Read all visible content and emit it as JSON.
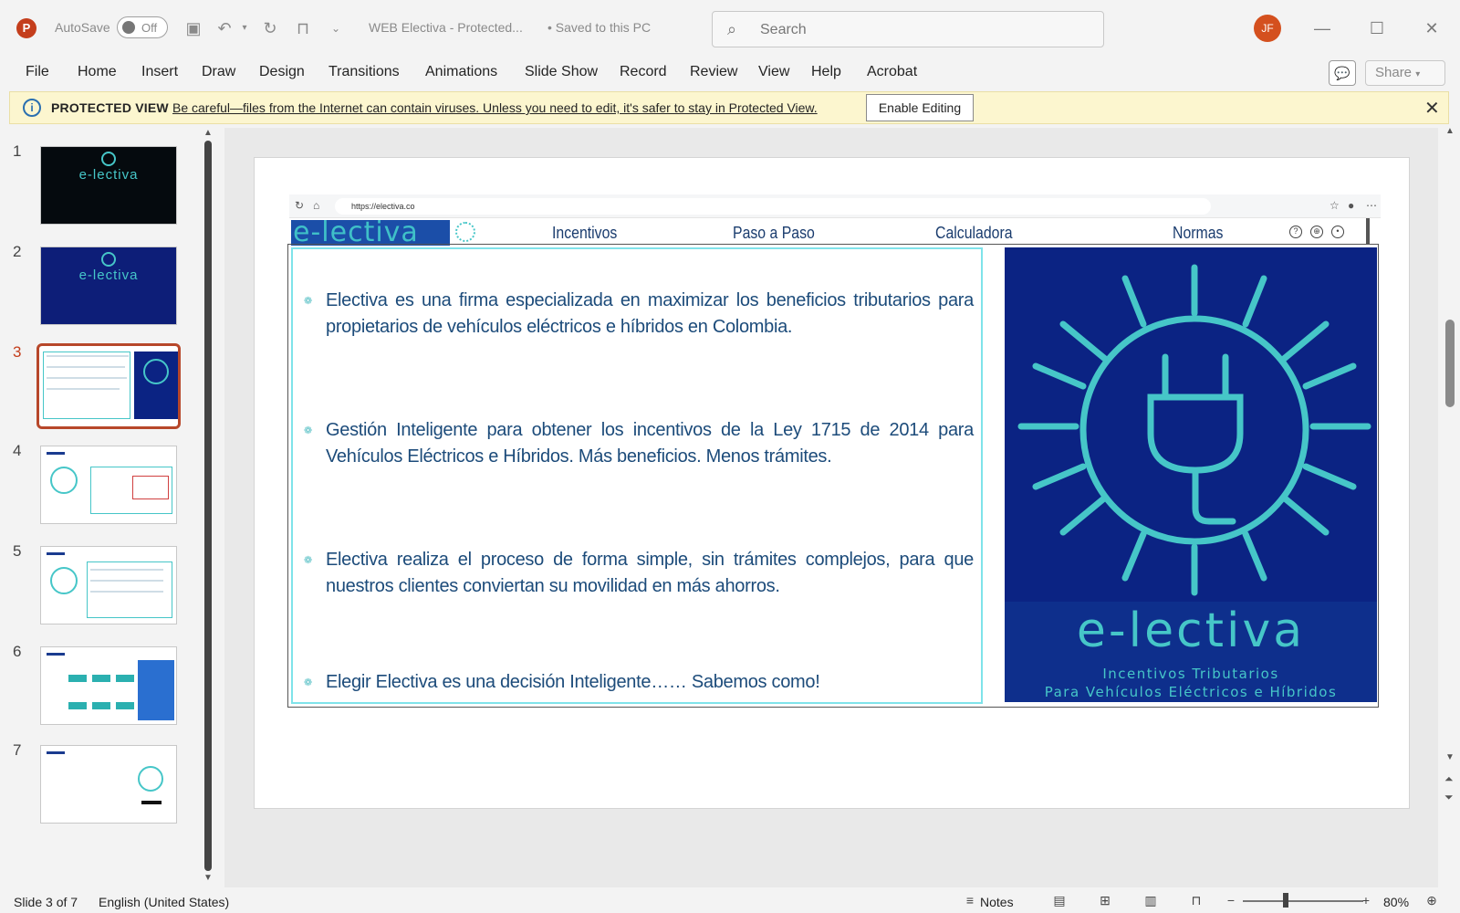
{
  "titlebar": {
    "autosave_label": "AutoSave",
    "autosave_state": "Off",
    "doc_title": "WEB Electiva  -  Protected...",
    "saved_status": "• Saved to this PC",
    "search_placeholder": "Search",
    "avatar_initials": "JF"
  },
  "ribbon": {
    "tabs": [
      "File",
      "Home",
      "Insert",
      "Draw",
      "Design",
      "Transitions",
      "Animations",
      "Slide Show",
      "Record",
      "Review",
      "View",
      "Help",
      "Acrobat"
    ],
    "share_label": "Share"
  },
  "protected_view": {
    "title": "PROTECTED VIEW",
    "message": "Be careful—files from the Internet can contain viruses. Unless you need to edit, it's safer to stay in Protected View.",
    "enable_label": "Enable Editing"
  },
  "thumbnails": {
    "numbers": [
      "1",
      "2",
      "3",
      "4",
      "5",
      "6",
      "7"
    ],
    "selected_index": 3,
    "logo_text": "e-lectiva"
  },
  "slide": {
    "browser_url": "https://electiva.co",
    "brand": "e-lectiva",
    "nav": [
      "Incentivos",
      "Paso a Paso",
      "Calculadora",
      "Normas"
    ],
    "paragraphs": [
      "Electiva es una firma especializada en maximizar los beneficios tributarios para propietarios de vehículos eléctricos e híbridos en Colombia.",
      "Gestión Inteligente para obtener los incentivos de la Ley 1715 de 2014 para Vehículos Eléctricos e Híbridos. Más beneficios. Menos trámites.",
      "Electiva realiza el proceso de forma simple, sin trámites complejos, para que nuestros clientes conviertan su movilidad en más ahorros.",
      "Elegir Electiva es una decisión Inteligente……  Sabemos como!"
    ],
    "logo": {
      "word": "e-lectiva",
      "sub1": "Incentivos Tributarios",
      "sub2": "Para Vehículos Eléctricos e Híbridos"
    }
  },
  "statusbar": {
    "slide_info": "Slide 3 of 7",
    "language": "English (United States)",
    "notes_label": "Notes",
    "zoom": "80%"
  },
  "colors": {
    "accent": "#c43e1c",
    "teal": "#46c6c8",
    "navy": "#0b2383",
    "text_blue": "#1c4b7a"
  }
}
